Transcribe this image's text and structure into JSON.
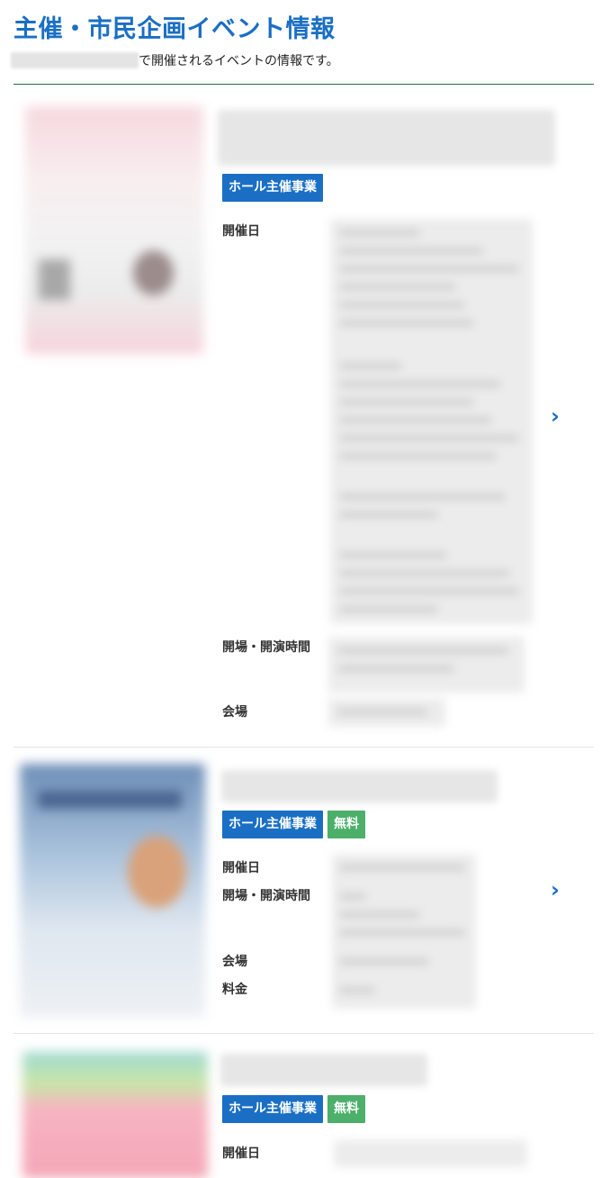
{
  "header": {
    "title": "主催・市民企画イベント情報",
    "lead_suffix": "で開催されるイベントの情報です。"
  },
  "labels": {
    "date": "開催日",
    "time": "開場・開演時間",
    "venue": "会場",
    "fee": "料金"
  },
  "badges": {
    "hall": "ホール主催事業",
    "free": "無料"
  },
  "icons": {
    "detail": "chevron-right-icon"
  },
  "colors": {
    "accent": "#1a6fc4",
    "free_badge": "#4caf6a",
    "rule": "#2c6e3b"
  }
}
